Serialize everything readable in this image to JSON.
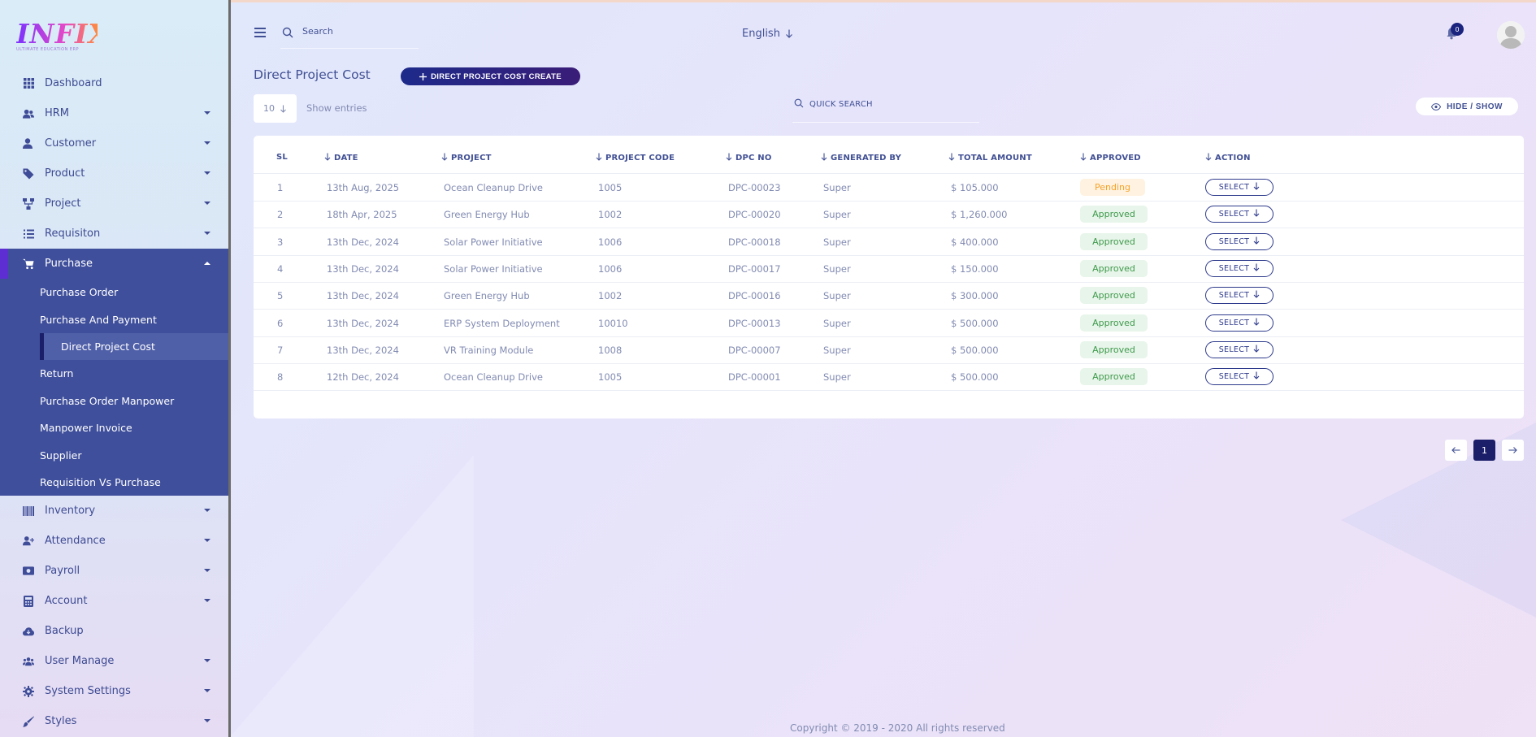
{
  "app": {
    "logo_text": "INFIX",
    "logo_sub": "ULTIMATE EDUCATION ERP"
  },
  "sidebar": {
    "items": [
      {
        "label": "Dashboard",
        "icon": "dashboard-icon",
        "has_caret": false
      },
      {
        "label": "HRM",
        "icon": "hrm-icon",
        "has_caret": true
      },
      {
        "label": "Customer",
        "icon": "customer-icon",
        "has_caret": true
      },
      {
        "label": "Product",
        "icon": "tag-icon",
        "has_caret": true
      },
      {
        "label": "Project",
        "icon": "project-icon",
        "has_caret": true
      },
      {
        "label": "Requisiton",
        "icon": "list-icon",
        "has_caret": true
      },
      {
        "label": "Purchase",
        "icon": "cart-icon",
        "has_caret": true,
        "expanded": true
      },
      {
        "label": "Inventory",
        "icon": "barcode-icon",
        "has_caret": true
      },
      {
        "label": "Attendance",
        "icon": "user-plus-icon",
        "has_caret": true
      },
      {
        "label": "Payroll",
        "icon": "money-icon",
        "has_caret": true
      },
      {
        "label": "Account",
        "icon": "calculator-icon",
        "has_caret": true
      },
      {
        "label": "Backup",
        "icon": "cloud-download-icon",
        "has_caret": false
      },
      {
        "label": "User Manage",
        "icon": "users-icon",
        "has_caret": true
      },
      {
        "label": "System Settings",
        "icon": "gear-icon",
        "has_caret": true
      },
      {
        "label": "Styles",
        "icon": "brush-icon",
        "has_caret": true
      }
    ],
    "purchase_sub": [
      "Purchase Order",
      "Purchase And Payment",
      "Direct Project Cost",
      "Return",
      "Purchase Order Manpower",
      "Manpower Invoice",
      "Supplier",
      "Requisition Vs Purchase"
    ]
  },
  "topbar": {
    "search_placeholder": "Search",
    "language": "English",
    "notification_count": "0"
  },
  "page": {
    "title": "Direct Project Cost",
    "create_button": "DIRECT PROJECT COST CREATE",
    "entries_value": "10",
    "entries_label": "Show entries",
    "quick_search_placeholder": "QUICK SEARCH",
    "hide_show": "HIDE / SHOW"
  },
  "table": {
    "columns": [
      "SL",
      "DATE",
      "PROJECT",
      "PROJECT CODE",
      "DPC NO",
      "GENERATED BY",
      "TOTAL AMOUNT",
      "APPROVED",
      "ACTION"
    ],
    "rows": [
      {
        "sl": "1",
        "date": "13th Aug, 2025",
        "project": "Ocean Cleanup Drive",
        "code": "1005",
        "dpc": "DPC-00023",
        "by": "Super",
        "amount": "$ 105.000",
        "status": "Pending",
        "action": "SELECT"
      },
      {
        "sl": "2",
        "date": "18th Apr, 2025",
        "project": "Green Energy Hub",
        "code": "1002",
        "dpc": "DPC-00020",
        "by": "Super",
        "amount": "$ 1,260.000",
        "status": "Approved",
        "action": "SELECT"
      },
      {
        "sl": "3",
        "date": "13th Dec, 2024",
        "project": "Solar Power Initiative",
        "code": "1006",
        "dpc": "DPC-00018",
        "by": "Super",
        "amount": "$ 400.000",
        "status": "Approved",
        "action": "SELECT"
      },
      {
        "sl": "4",
        "date": "13th Dec, 2024",
        "project": "Solar Power Initiative",
        "code": "1006",
        "dpc": "DPC-00017",
        "by": "Super",
        "amount": "$ 150.000",
        "status": "Approved",
        "action": "SELECT"
      },
      {
        "sl": "5",
        "date": "13th Dec, 2024",
        "project": "Green Energy Hub",
        "code": "1002",
        "dpc": "DPC-00016",
        "by": "Super",
        "amount": "$ 300.000",
        "status": "Approved",
        "action": "SELECT"
      },
      {
        "sl": "6",
        "date": "13th Dec, 2024",
        "project": "ERP System Deployment",
        "code": "10010",
        "dpc": "DPC-00013",
        "by": "Super",
        "amount": "$ 500.000",
        "status": "Approved",
        "action": "SELECT"
      },
      {
        "sl": "7",
        "date": "13th Dec, 2024",
        "project": "VR Training Module",
        "code": "1008",
        "dpc": "DPC-00007",
        "by": "Super",
        "amount": "$ 500.000",
        "status": "Approved",
        "action": "SELECT"
      },
      {
        "sl": "8",
        "date": "12th Dec, 2024",
        "project": "Ocean Cleanup Drive",
        "code": "1005",
        "dpc": "DPC-00001",
        "by": "Super",
        "amount": "$ 500.000",
        "status": "Approved",
        "action": "SELECT"
      }
    ]
  },
  "pagination": {
    "current": "1"
  },
  "footer": {
    "text": "Copyright © 2019 - 2020 All rights reserved"
  },
  "colors": {
    "sidebar_active": "#3f4f9b",
    "accent": "#1b1f6a",
    "approved": "#3e9a4c",
    "pending": "#f5a32a"
  }
}
